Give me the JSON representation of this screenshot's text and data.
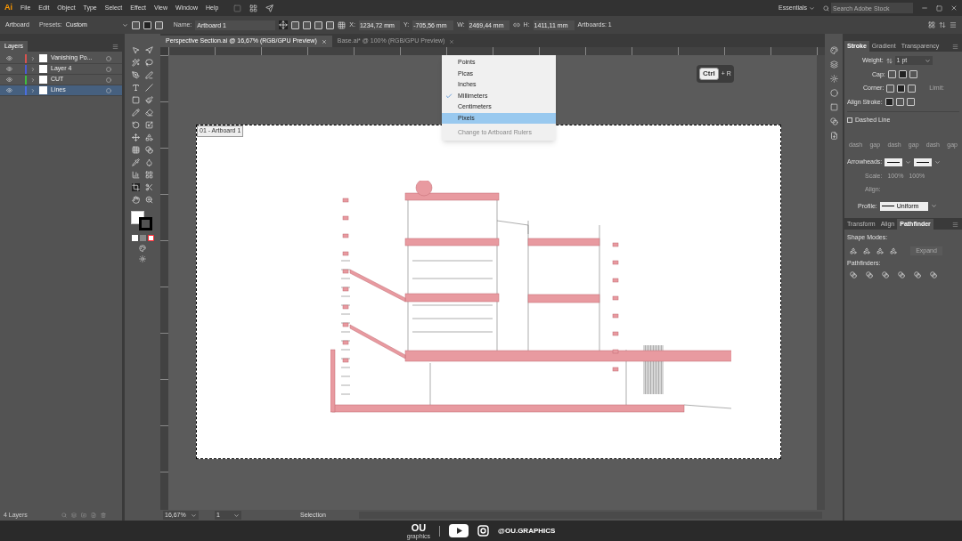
{
  "app": {
    "logo": "Ai"
  },
  "menu": [
    "File",
    "Edit",
    "Object",
    "Type",
    "Select",
    "Effect",
    "View",
    "Window",
    "Help"
  ],
  "workspace": "Essentials",
  "search": {
    "placeholder": "Search Adobe Stock"
  },
  "control_bar": {
    "mode": "Artboard",
    "presets_label": "Presets:",
    "presets_value": "Custom",
    "name_label": "Name:",
    "name_value": "Artboard 1",
    "fields": [
      {
        "label": "X:",
        "value": "1234,72 mm"
      },
      {
        "label": "Y:",
        "value": "-705,56 mm"
      },
      {
        "label": "W:",
        "value": "2469,44 mm"
      },
      {
        "label": "H:",
        "value": "1411,11 mm"
      }
    ],
    "artboards": "Artboards: 1"
  },
  "document_tabs": [
    {
      "label": "Perspective Section.ai @ 16,67% (RGB/GPU Preview)",
      "selected": true
    },
    {
      "label": "Base.ai* @ 100% (RGB/GPU Preview)",
      "selected": false
    }
  ],
  "layers_panel": {
    "title": "Layers",
    "layers": [
      {
        "name": "Vanishing Po...",
        "color": "#d9534f",
        "selected": false
      },
      {
        "name": "Layer 4",
        "color": "#4a5bd6",
        "selected": false
      },
      {
        "name": "CUT",
        "color": "#3fbf3f",
        "selected": false
      },
      {
        "name": "Lines",
        "color": "#4a6ee0",
        "selected": true
      }
    ],
    "footer": "4 Layers"
  },
  "ruler_menu": [
    {
      "label": "Points",
      "checked": false,
      "selected": false,
      "disabled": false
    },
    {
      "label": "Picas",
      "checked": false,
      "selected": false,
      "disabled": false
    },
    {
      "label": "Inches",
      "checked": false,
      "selected": false,
      "disabled": false
    },
    {
      "label": "Millimeters",
      "checked": true,
      "selected": false,
      "disabled": false
    },
    {
      "label": "Centimeters",
      "checked": false,
      "selected": false,
      "disabled": false
    },
    {
      "label": "Pixels",
      "checked": false,
      "selected": true,
      "disabled": false
    },
    {
      "label": "Change to Artboard Rulers",
      "checked": false,
      "selected": false,
      "disabled": true
    }
  ],
  "artboard_label": "01 - Artboard 1",
  "shortcut": {
    "key": "Ctrl",
    "rest": "+ R"
  },
  "stroke_panel": {
    "tabs": [
      {
        "label": "Stroke",
        "selected": true
      },
      {
        "label": "Gradient",
        "selected": false
      },
      {
        "label": "Transparency",
        "selected": false
      }
    ],
    "weight_label": "Weight:",
    "weight_value": "1 pt",
    "cap_label": "Cap:",
    "corner_label": "Corner:",
    "limit_label": "Limit:",
    "align_label": "Align Stroke:",
    "dashed": {
      "label": "Dashed Line",
      "checked": false
    },
    "dash_labels": [
      "dash",
      "gap",
      "dash",
      "gap",
      "dash",
      "gap"
    ],
    "arrowheads_label": "Arrowheads:",
    "scale_label": "Scale:",
    "scale_values": [
      "100%",
      "100%"
    ],
    "arrow_align_label": "Align:",
    "profile_label": "Profile:",
    "profile_value": "Uniform"
  },
  "pathfinder_panel": {
    "tabs": [
      {
        "label": "Transform",
        "selected": false
      },
      {
        "label": "Align",
        "selected": false
      },
      {
        "label": "Pathfinder",
        "selected": true
      }
    ],
    "shape_modes": "Shape Modes:",
    "expand": "Expand",
    "pathfinders": "Pathfinders:"
  },
  "status_bar": {
    "zoom": "16,67%",
    "artboard": "1",
    "tool": "Selection"
  },
  "footer": {
    "logo": "OU",
    "logo_sub": "graphics",
    "handle": "@OU.GRAPHICS"
  }
}
